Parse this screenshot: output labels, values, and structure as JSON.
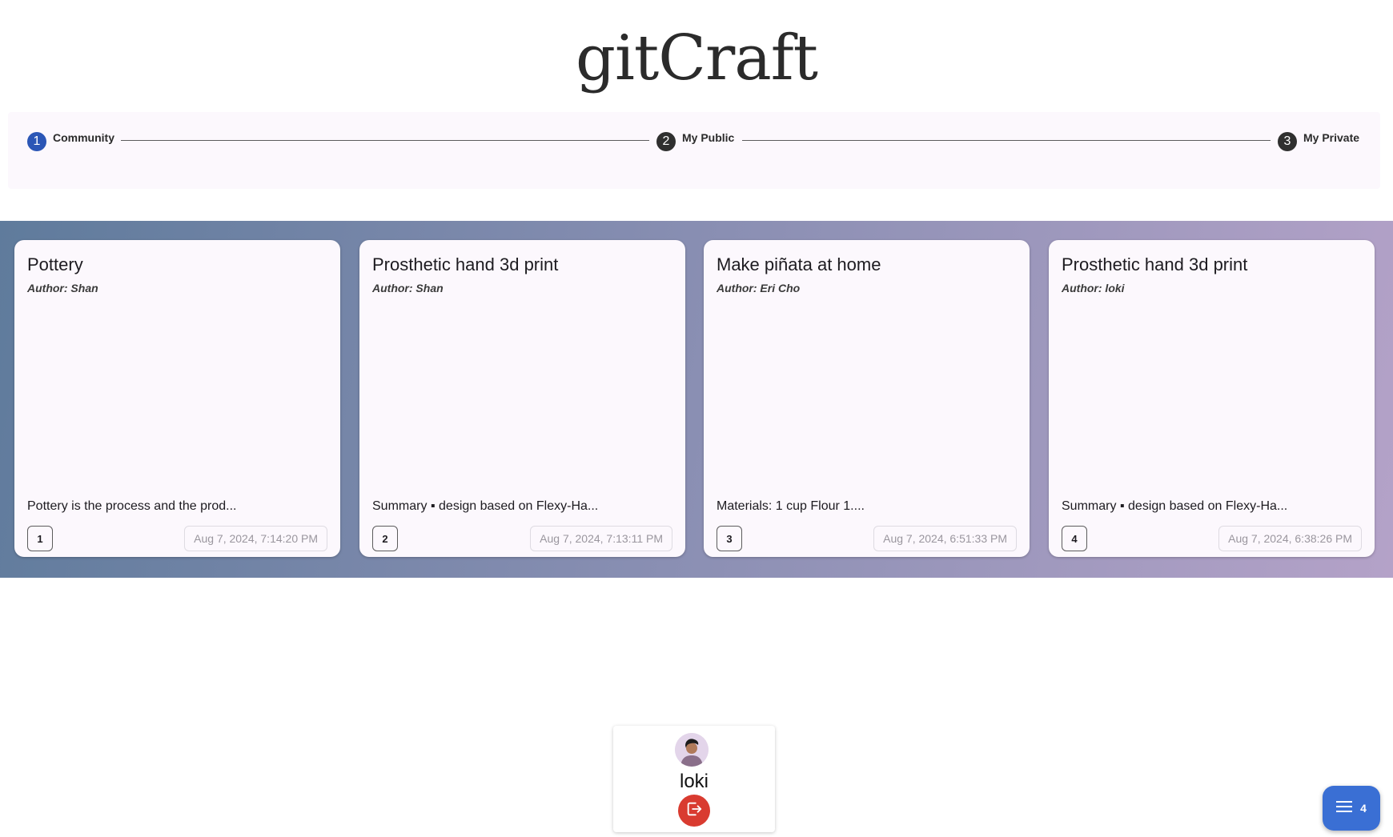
{
  "app": {
    "logo": "gitCraft"
  },
  "stepper": {
    "steps": [
      {
        "number": "1",
        "label": "Community",
        "active": true
      },
      {
        "number": "2",
        "label": "My Public",
        "active": false
      },
      {
        "number": "3",
        "label": "My Private",
        "active": false
      }
    ]
  },
  "cards": [
    {
      "title": "Pottery",
      "author": "Author: Shan",
      "summary": "Pottery is the process and the prod...",
      "number": "1",
      "date": "Aug 7, 2024, 7:14:20 PM"
    },
    {
      "title": "Prosthetic hand 3d print",
      "author": "Author: Shan",
      "summary": "Summary ▪ design based on Flexy-Ha...",
      "number": "2",
      "date": "Aug 7, 2024, 7:13:11 PM"
    },
    {
      "title": "Make piñata at home",
      "author": "Author: Eri Cho",
      "summary": "Materials: 1 cup Flour 1....",
      "number": "3",
      "date": "Aug 7, 2024, 6:51:33 PM"
    },
    {
      "title": "Prosthetic hand 3d print",
      "author": "Author: loki",
      "summary": "Summary ▪ design based on Flexy-Ha...",
      "number": "4",
      "date": "Aug 7, 2024, 6:38:26 PM"
    }
  ],
  "user": {
    "name": "loki",
    "avatar_icon": "user-avatar",
    "logout_icon": "logout-icon"
  },
  "fab": {
    "icon": "menu-icon",
    "count": "4"
  },
  "colors": {
    "accent": "#2b56b6",
    "fab": "#3a6fd4",
    "logout": "#d93b30"
  }
}
